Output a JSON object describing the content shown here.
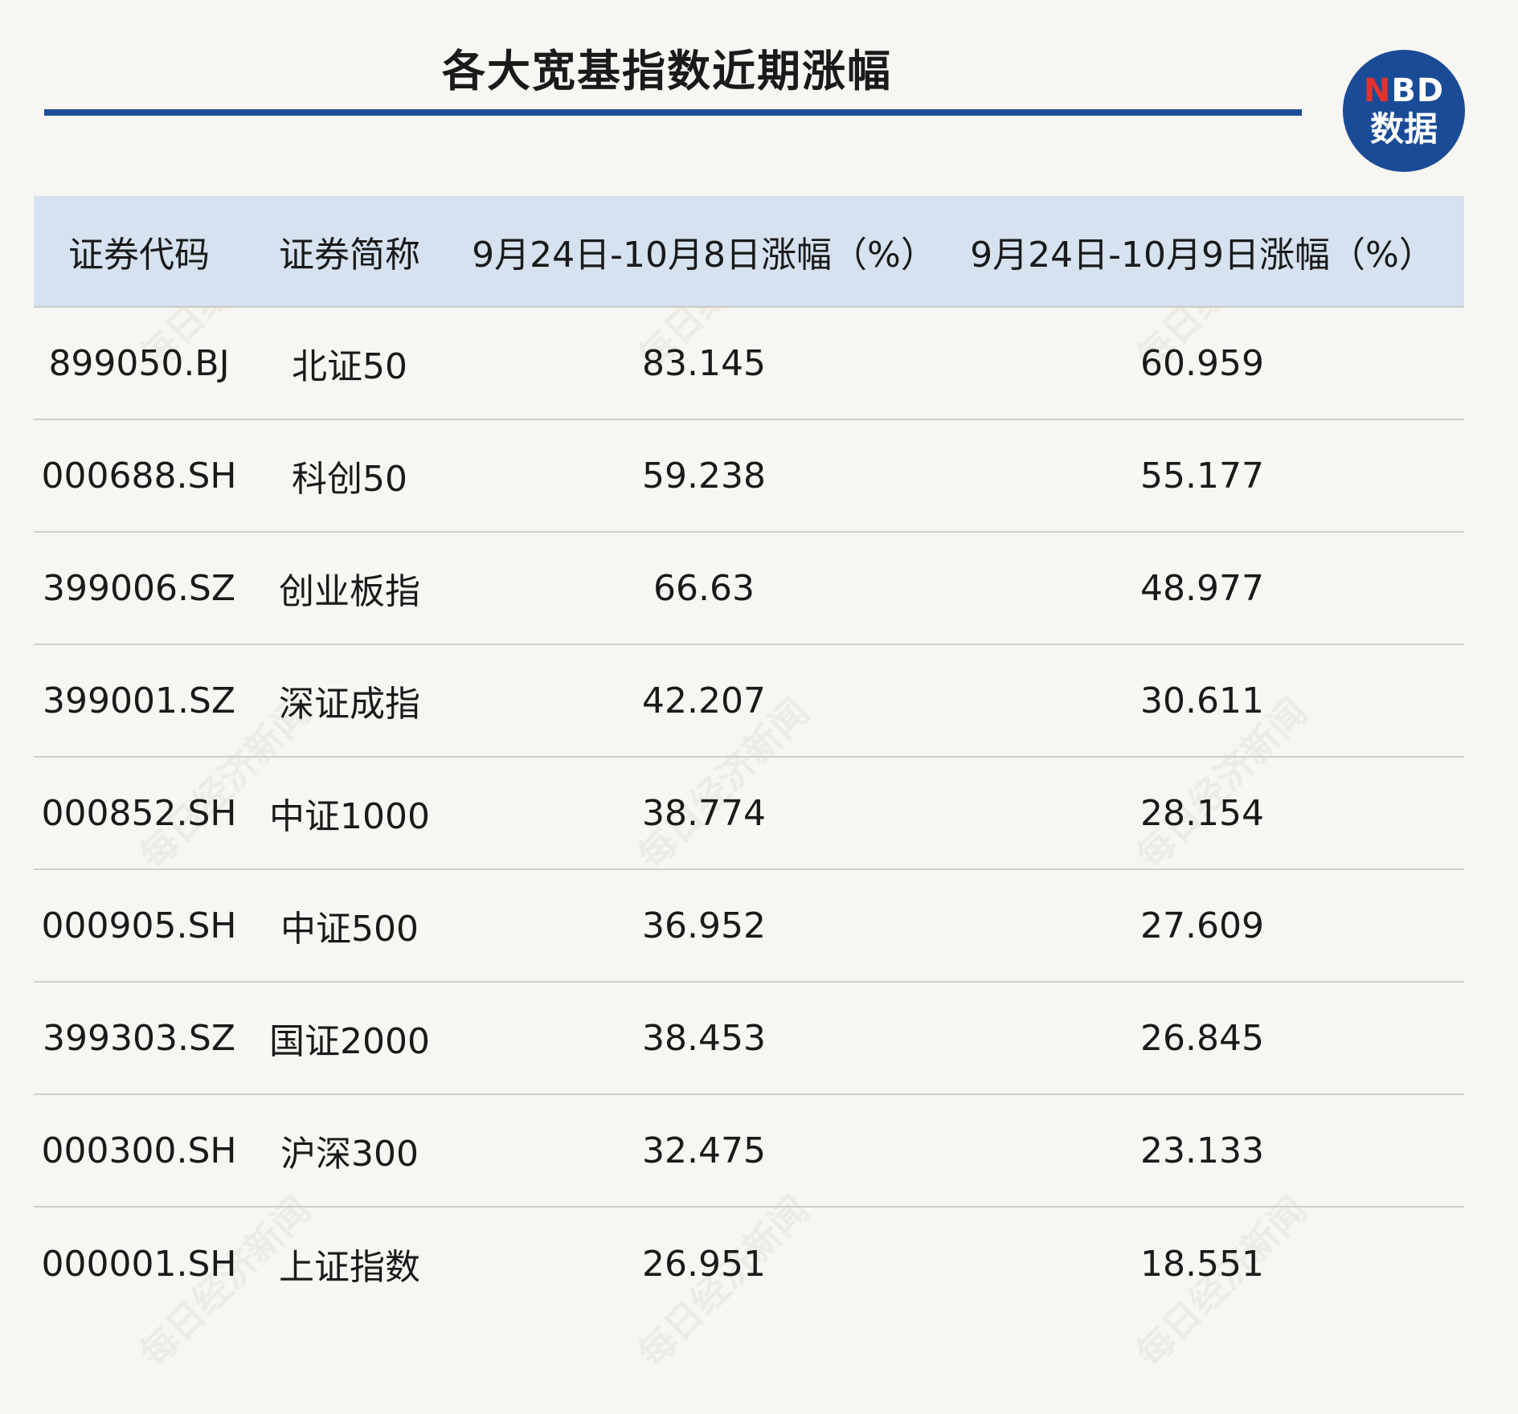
{
  "title": "各大宽基指数近期涨幅",
  "logo": {
    "n": "N",
    "rest": "BD",
    "line2": "数据"
  },
  "watermark_text": "每日经济新闻",
  "chart_data": {
    "type": "table",
    "title": "各大宽基指数近期涨幅",
    "columns": [
      "证券代码",
      "证券简称",
      "9月24日-10月8日涨幅（%）",
      "9月24日-10月9日涨幅（%）"
    ],
    "rows": [
      [
        "899050.BJ",
        "北证50",
        "83.145",
        "60.959"
      ],
      [
        "000688.SH",
        "科创50",
        "59.238",
        "55.177"
      ],
      [
        "399006.SZ",
        "创业板指",
        "66.63",
        "48.977"
      ],
      [
        "399001.SZ",
        "深证成指",
        "42.207",
        "30.611"
      ],
      [
        "000852.SH",
        "中证1000",
        "38.774",
        "28.154"
      ],
      [
        "000905.SH",
        "中证500",
        "36.952",
        "27.609"
      ],
      [
        "399303.SZ",
        "国证2000",
        "38.453",
        "26.845"
      ],
      [
        "000300.SH",
        "沪深300",
        "32.475",
        "23.133"
      ],
      [
        "000001.SH",
        "上证指数",
        "26.951",
        "18.551"
      ]
    ]
  }
}
